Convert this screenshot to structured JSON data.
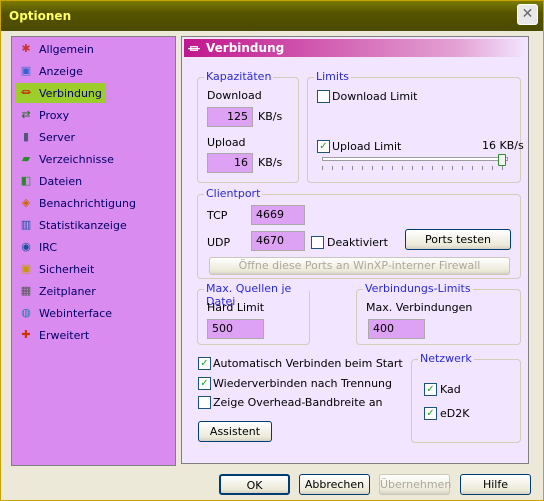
{
  "window": {
    "title": "Optionen",
    "close_glyph": "✕"
  },
  "sidebar": {
    "items": [
      {
        "label": "Allgemein",
        "icon": "settings-icon"
      },
      {
        "label": "Anzeige",
        "icon": "display-icon"
      },
      {
        "label": "Verbindung",
        "icon": "plug-icon"
      },
      {
        "label": "Proxy",
        "icon": "proxy-icon"
      },
      {
        "label": "Server",
        "icon": "server-icon"
      },
      {
        "label": "Verzeichnisse",
        "icon": "folder-icon"
      },
      {
        "label": "Dateien",
        "icon": "files-icon"
      },
      {
        "label": "Benachrichtigung",
        "icon": "notification-icon"
      },
      {
        "label": "Statistikanzeige",
        "icon": "statistics-icon"
      },
      {
        "label": "IRC",
        "icon": "irc-icon"
      },
      {
        "label": "Sicherheit",
        "icon": "lock-icon"
      },
      {
        "label": "Zeitplaner",
        "icon": "calendar-icon"
      },
      {
        "label": "Webinterface",
        "icon": "globe-icon"
      },
      {
        "label": "Erweitert",
        "icon": "advanced-icon"
      }
    ],
    "selected": "Verbindung"
  },
  "panel": {
    "title": "Verbindung",
    "capacities": {
      "title": "Kapazitäten",
      "download_label": "Download",
      "download_value": "125",
      "download_unit": "KB/s",
      "upload_label": "Upload",
      "upload_value": "16",
      "upload_unit": "KB/s"
    },
    "limits": {
      "title": "Limits",
      "download_limit_label": "Download Limit",
      "download_limit_checked": false,
      "upload_limit_label": "Upload Limit",
      "upload_limit_checked": true,
      "upload_limit_value": "16 KB/s",
      "slider_level": 1.0
    },
    "clientport": {
      "title": "Clientport",
      "tcp_label": "TCP",
      "tcp_value": "4669",
      "udp_label": "UDP",
      "udp_value": "4670",
      "disabled_label": "Deaktiviert",
      "disabled_checked": false,
      "test_button": "Ports testen",
      "firewall_button": "Öffne diese Ports an WinXP-interner Firewall"
    },
    "max_sources": {
      "title": "Max. Quellen je Datei",
      "label": "Hard Limit",
      "value": "500"
    },
    "conn_limits": {
      "title": "Verbindungs-Limits",
      "label": "Max. Verbindungen",
      "value": "400"
    },
    "options": {
      "auto_connect": "Automatisch Verbinden beim Start",
      "auto_connect_checked": true,
      "reconnect": "Wiederverbinden nach Trennung",
      "reconnect_checked": true,
      "overhead": "Zeige Overhead-Bandbreite an",
      "overhead_checked": false
    },
    "assistant_button": "Assistent",
    "network": {
      "title": "Netzwerk",
      "kad": "Kad",
      "kad_checked": true,
      "ed2k": "eD2K",
      "ed2k_checked": true
    }
  },
  "footer": {
    "ok": "OK",
    "cancel": "Abbrechen",
    "apply": "Übernehmen",
    "help": "Hilfe"
  }
}
